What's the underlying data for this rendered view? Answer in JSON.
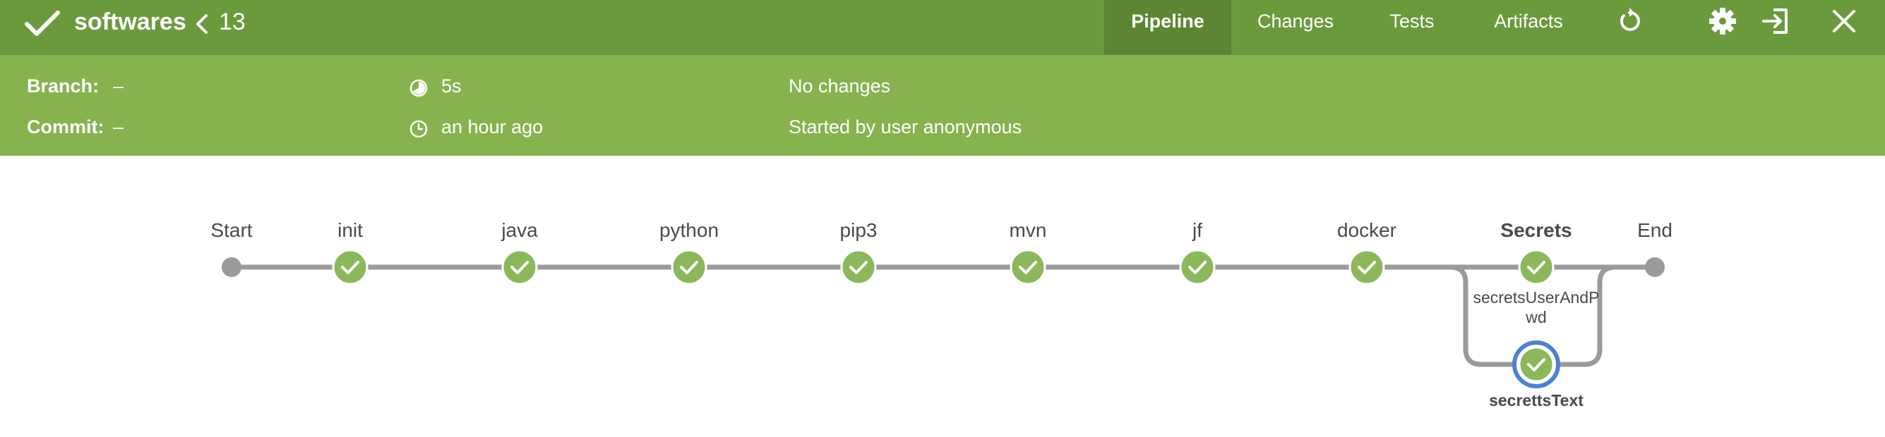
{
  "header": {
    "job_name": "softwares",
    "run_number": "13",
    "tabs": [
      {
        "label": "Pipeline",
        "active": true
      },
      {
        "label": "Changes",
        "active": false
      },
      {
        "label": "Tests",
        "active": false
      },
      {
        "label": "Artifacts",
        "active": false
      }
    ],
    "icons": [
      "check-icon",
      "chevron-left-icon",
      "replay-icon",
      "gear-icon",
      "open-external-icon",
      "close-icon"
    ],
    "colors": {
      "topbar": "#6b9a3d",
      "infobar": "#86b34e",
      "success": "#8cb85c",
      "line": "#9a9a9a",
      "selected_ring": "#4a82d4"
    }
  },
  "info": {
    "branch_label": "Branch:",
    "branch_value": "–",
    "commit_label": "Commit:",
    "commit_value": "–",
    "duration": "5s",
    "time_ago": "an hour ago",
    "changes": "No changes",
    "started_by": "Started by user anonymous"
  },
  "pipeline": {
    "start_label": "Start",
    "end_label": "End",
    "stages": [
      {
        "label": "init",
        "status": "success"
      },
      {
        "label": "java",
        "status": "success"
      },
      {
        "label": "python",
        "status": "success"
      },
      {
        "label": "pip3",
        "status": "success"
      },
      {
        "label": "mvn",
        "status": "success"
      },
      {
        "label": "jf",
        "status": "success"
      },
      {
        "label": "docker",
        "status": "success"
      }
    ],
    "parallel_stage": {
      "label": "Secrets",
      "branches": [
        {
          "label_line1": "secretsUserAndP",
          "label_line2": "wd",
          "status": "success",
          "selected": false
        },
        {
          "label": "secrettsText",
          "status": "success",
          "selected": true
        }
      ]
    }
  }
}
